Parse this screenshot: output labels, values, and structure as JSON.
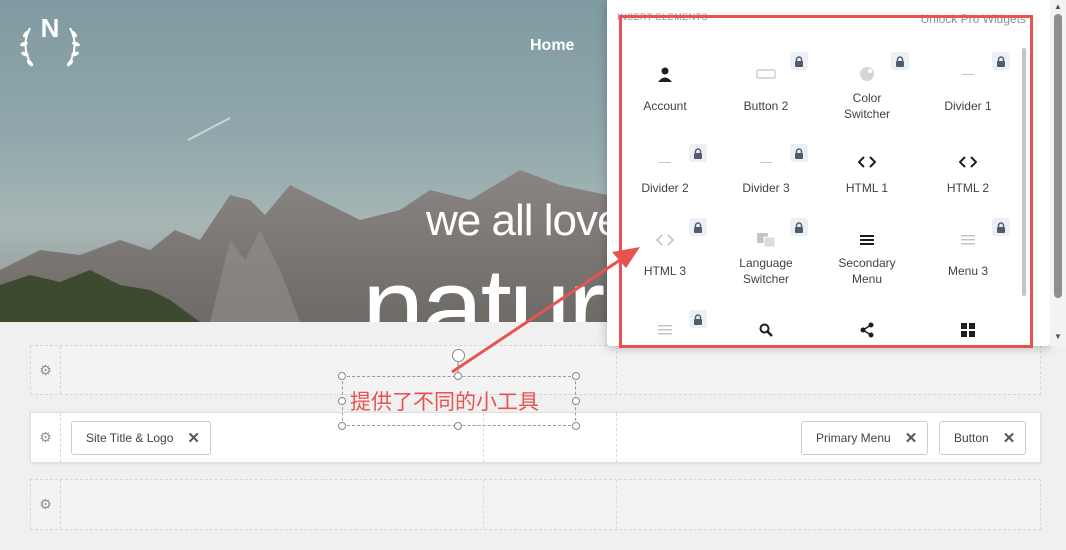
{
  "hero": {
    "logo_letter": "N",
    "nav_home": "Home",
    "subtitle": "we all love",
    "big_title": "natur"
  },
  "panel": {
    "header_left": "INSERT ELEMENTS",
    "header_right": "Unlock Pro Widgets",
    "items": [
      {
        "label": "Account",
        "icon": "user-icon",
        "locked": false
      },
      {
        "label": "Button 2",
        "icon": "button-icon",
        "locked": true
      },
      {
        "label": "Color\nSwitcher",
        "icon": "color-switcher-icon",
        "locked": true
      },
      {
        "label": "Divider 1",
        "icon": "divider-icon",
        "locked": true
      },
      {
        "label": "Divider 2",
        "icon": "divider-icon",
        "locked": true
      },
      {
        "label": "Divider 3",
        "icon": "divider-icon",
        "locked": true
      },
      {
        "label": "HTML 1",
        "icon": "code-icon",
        "locked": false
      },
      {
        "label": "HTML 2",
        "icon": "code-icon",
        "locked": false
      },
      {
        "label": "HTML 3",
        "icon": "code-icon",
        "locked": true
      },
      {
        "label": "Language\nSwitcher",
        "icon": "language-icon",
        "locked": true
      },
      {
        "label": "Secondary\nMenu",
        "icon": "menu-icon",
        "locked": false
      },
      {
        "label": "Menu 3",
        "icon": "menu-icon",
        "locked": true
      }
    ],
    "bottom_icons": [
      "menu-icon",
      "search-icon",
      "share-icon",
      "grid-icon"
    ]
  },
  "builder": {
    "chip_site_title": "Site Title & Logo",
    "chip_primary_menu": "Primary Menu",
    "chip_button": "Button",
    "remove_symbol": "✕"
  },
  "annotation": {
    "text": "提供了不同的小工具",
    "color": "#e8534f"
  }
}
